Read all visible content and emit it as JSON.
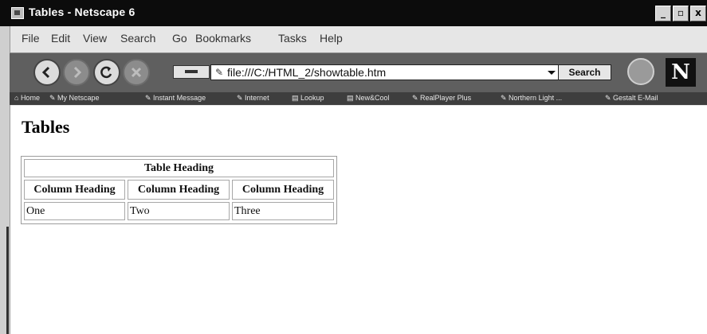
{
  "window": {
    "title": "Tables - Netscape 6",
    "controls": {
      "minimize": "_",
      "maximize": "▫",
      "close": "x"
    }
  },
  "menubar": {
    "items": [
      "File",
      "Edit",
      "View",
      "Search",
      "Go",
      "Bookmarks",
      "Tasks",
      "Help"
    ]
  },
  "navigation": {
    "url": "file:///C:/HTML_2/showtable.htm",
    "search_label": "Search",
    "logo": "N",
    "bookmark_glyph": "✎"
  },
  "personal_toolbar": {
    "items": [
      "Home",
      "My Netscape",
      "Instant Message",
      "Internet",
      "Lookup",
      "New&Cool",
      "RealPlayer Plus",
      "Northern Light ...",
      "Gestalt E-Mail"
    ]
  },
  "page": {
    "heading": "Tables",
    "table": {
      "caption": "Table Heading",
      "column_headers": [
        "Column Heading",
        "Column Heading",
        "Column Heading"
      ],
      "rows": [
        [
          "One",
          "Two",
          "Three"
        ]
      ]
    }
  },
  "colors": {
    "titlebar": "#0c0c0c",
    "navbar": "#5f5f5f",
    "personalbar": "#3e3e3e"
  }
}
